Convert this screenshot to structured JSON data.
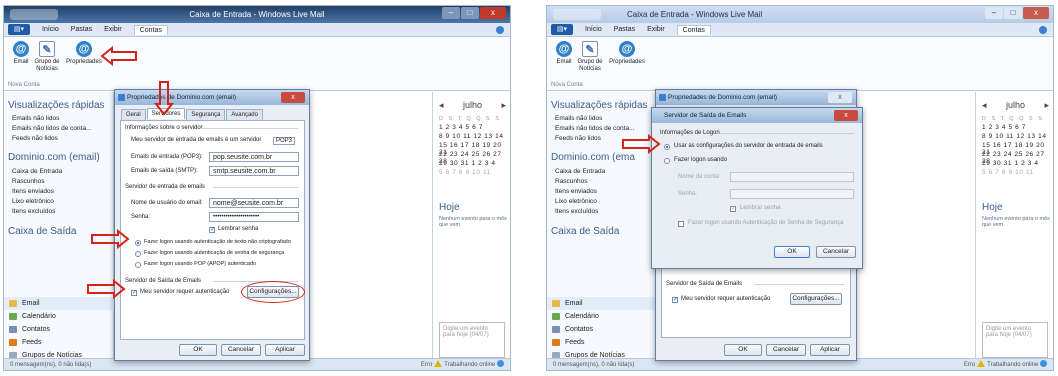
{
  "colors": {
    "arrow": "#d4231b",
    "accent": "#1f5aa8",
    "titlebar_dark": "#223f66"
  },
  "shotA": {
    "window": {
      "title": "Caixa de Entrada - Windows Live Mail"
    },
    "tabs": [
      "Início",
      "Pastas",
      "Exibir",
      "Contas"
    ],
    "ribbon": {
      "buttons": [
        {
          "icon": "email-at-icon",
          "label": "Email"
        },
        {
          "icon": "newsgroup-icon",
          "label": "Grupo de Notícias"
        },
        {
          "icon": "properties-at-icon",
          "label": "Propriedades"
        }
      ],
      "group": "Nova Conta"
    },
    "sidebar": {
      "quick_title": "Visualizações rápidas",
      "quick_items": [
        "Emails não lidos",
        "Emails não lidos de conta...",
        "Feeds não lidos"
      ],
      "account_title": "Dominio.com (email)",
      "folders": [
        "Caixa de Entrada",
        "Rascunhos",
        "Itens enviados",
        "Lixo eletrônico",
        "Itens excluídos"
      ],
      "outbox": "Caixa de Saída",
      "nav": [
        "Email",
        "Calendário",
        "Contatos",
        "Feeds",
        "Grupos de Notícias"
      ]
    },
    "calendar": {
      "month": "julho",
      "days": "D S T Q Q S S",
      "rows": [
        "1 2 3 4 5 6 7",
        "8 9 10 11 12 13 14",
        "15 16 17 18 19 20 21",
        "22 23 24 25 26 27 28",
        "29 30 31 1 2 3 4",
        "5 6 7 8 9 10 11"
      ],
      "today_label": "Hoje",
      "no_events": "Nenhum evento para o mês que vem",
      "event_placeholder": "Digite um evento para hoje (04/07)"
    },
    "status": {
      "left": "0 mensagem(ns), 0 não lida(s)",
      "right": "Erro",
      "online": "Trabalhando online"
    },
    "dialog": {
      "title": "Propriedades de Dominio.com (email)",
      "tabs": [
        "Geral",
        "Servidores",
        "Segurança",
        "Avançado"
      ],
      "server_info": "Informações sobre o servidor",
      "incoming_type_label": "Meu servidor de entrada de emails é um servidor",
      "incoming_type_value": "POP3",
      "pop3_label": "Emails de entrada (POP3):",
      "pop3_value": "pop.seusite.com.br",
      "smtp_label": "Emails de saída (SMTP):",
      "smtp_value": "smtp.seusite.com.br",
      "incoming_server": "Servidor de entrada de emails",
      "user_label": "Nome de usuário do email:",
      "user_value": "nome@seusite.com.br",
      "pass_label": "Senha:",
      "pass_value": "••••••••••••••••••••••",
      "remember": "Lembrar senha",
      "opt1": "Fazer logon usando autenticação de texto não criptografado",
      "opt2": "Fazer logon usando autenticação de senha de segurança",
      "opt3": "Fazer logon usando POP (APOP) autenticado",
      "outgoing_server": "Servidor de Saída de Emails",
      "requires_auth": "Meu servidor requer autenticação",
      "settings": "Configurações...",
      "ok": "OK",
      "cancel": "Cancelar",
      "apply": "Aplicar"
    }
  },
  "shotB": {
    "window": {
      "title": "Caixa de Entrada - Windows Live Mail"
    },
    "tabs": [
      "Início",
      "Pastas",
      "Exibir",
      "Contas"
    ],
    "ribbon": {
      "buttons": [
        {
          "icon": "email-at-icon",
          "label": "Email"
        },
        {
          "icon": "newsgroup-icon",
          "label": "Grupo de Notícias"
        },
        {
          "icon": "properties-at-icon",
          "label": "Propriedades"
        }
      ],
      "group": "Nova Conta"
    },
    "sidebar": {
      "quick_title": "Visualizações rápidas",
      "quick_items": [
        "Emails não lidos",
        "Emails não lidos de conta...",
        "Feeds não lidos"
      ],
      "account_title": "Dominio.com (ema",
      "folders": [
        "Caixa de Entrada",
        "Rascunhos",
        "Itens enviados",
        "Lixo eletrônico",
        "Itens excluídos"
      ],
      "outbox": "Caixa de Saída",
      "nav": [
        "Email",
        "Calendário",
        "Contatos",
        "Feeds",
        "Grupos de Notícias"
      ]
    },
    "calendar": {
      "month": "julho",
      "days": "D S T Q Q S S",
      "rows": [
        "1 2 3 4 5 6 7",
        "8 9 10 11 12 13 14",
        "15 16 17 18 19 20 21",
        "22 23 24 25 26 27 28",
        "29 30 31 1 2 3 4",
        "5 6 7 8 9 10 11"
      ],
      "today_label": "Hoje",
      "no_events": "Nenhum evento para o mês que vem",
      "event_placeholder": "Digite um evento para hoje (04/07)"
    },
    "status": {
      "left": "0 mensagem(ns), 0 não lida(s)",
      "right": "Erro",
      "online": "Trabalhando online"
    },
    "back_dialog": {
      "title": "Propriedades de Dominio.com (email)",
      "outgoing_server": "Servidor de Saída de Emails",
      "requires_auth": "Meu servidor requer autenticação",
      "settings": "Configurações...",
      "ok": "OK",
      "cancel": "Cancelar",
      "apply": "Aplicar"
    },
    "dialog": {
      "title": "Servidor de Saída de Emails",
      "logon_info": "Informações de Logon",
      "opt_same": "Usar as configurações do servidor de entrada de emails",
      "opt_logon": "Fazer logon usando",
      "account_label": "Nome da conta:",
      "password_label": "Senha:",
      "remember": "Lembrar senha",
      "spa": "Fazer logon usando Autenticação de Senha de Segurança",
      "ok": "OK",
      "cancel": "Cancelar"
    }
  }
}
